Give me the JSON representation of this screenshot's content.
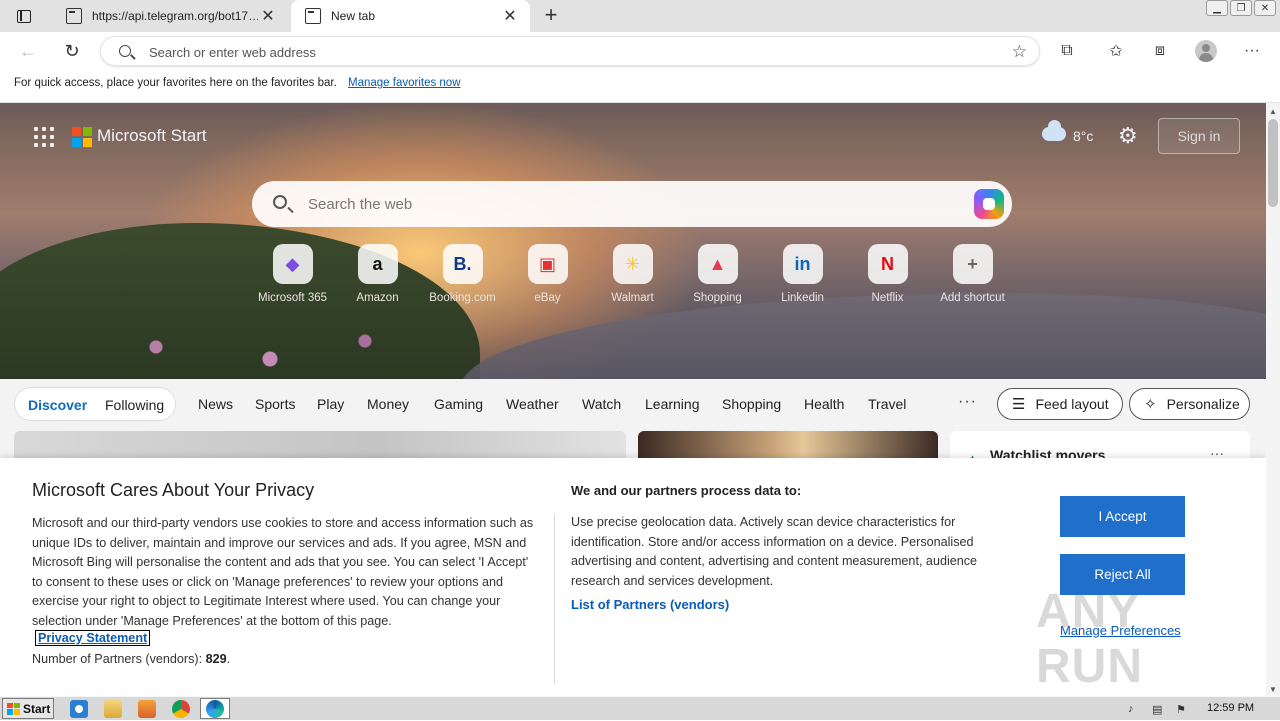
{
  "browser": {
    "tabs": [
      {
        "title": "https://api.telegram.org/bot17…",
        "active": false
      },
      {
        "title": "New tab",
        "active": true
      }
    ],
    "address_placeholder": "Search or enter web address",
    "favbar_message": "For quick access, place your favorites here on the favorites bar.",
    "favbar_link": "Manage favorites now"
  },
  "start": {
    "brand": "Microsoft Start",
    "temperature": "8°c",
    "signin_label": "Sign in",
    "search_placeholder": "Search the web",
    "shortcuts": [
      {
        "label": "Microsoft 365",
        "glyph": "◆",
        "color": "#7a4ee0"
      },
      {
        "label": "Amazon",
        "glyph": "a",
        "color": "#111111"
      },
      {
        "label": "Booking.com",
        "glyph": "B.",
        "color": "#0c3b8c"
      },
      {
        "label": "eBay",
        "glyph": "▣",
        "color": "#e53238"
      },
      {
        "label": "Walmart",
        "glyph": "✳",
        "color": "#ffc220"
      },
      {
        "label": "Shopping",
        "glyph": "▲",
        "color": "#e03b4f"
      },
      {
        "label": "Linkedin",
        "glyph": "in",
        "color": "#0a66c2"
      },
      {
        "label": "Netflix",
        "glyph": "N",
        "color": "#e50914"
      },
      {
        "label": "Add shortcut",
        "glyph": "+",
        "color": "#666666"
      }
    ]
  },
  "feed": {
    "tab_active": "Discover",
    "tab_other": "Following",
    "categories": [
      "News",
      "Sports",
      "Play",
      "Money",
      "Gaming",
      "Weather",
      "Watch",
      "Learning",
      "Shopping",
      "Health",
      "Travel"
    ],
    "more": "···",
    "feed_layout_label": "Feed layout",
    "personalize_label": "Personalize",
    "watchlist_title": "Watchlist movers"
  },
  "privacy": {
    "title": "Microsoft Cares About Your Privacy",
    "body": "Microsoft and our third-party vendors use cookies to store and access information such as unique IDs to deliver, maintain and improve our services and ads. If you agree, MSN and Microsoft Bing will personalise the content and ads that you see. You can select 'I Accept' to consent to these uses or click on 'Manage preferences' to review your options and exercise your right to object to Legitimate Interest where used.  You can change your selection under 'Manage Preferences' at the bottom of this page.",
    "privacy_link": "Privacy Statement",
    "partners_label": "Number of Partners (vendors):",
    "partners_count": "829",
    "partners_suffix": ".",
    "right_title": "We and our partners process data to:",
    "right_body": "Use precise geolocation data. Actively scan device characteristics for identification. Store and/or access information on a device. Personalised advertising and content, advertising and content measurement, audience research and services development.",
    "vendors_link": "List of Partners (vendors)",
    "accept_label": "I Accept",
    "reject_label": "Reject All",
    "manage_label": "Manage Preferences"
  },
  "watermark": "ANY RUN",
  "taskbar": {
    "start_label": "Start",
    "clock": "12:59 PM"
  }
}
